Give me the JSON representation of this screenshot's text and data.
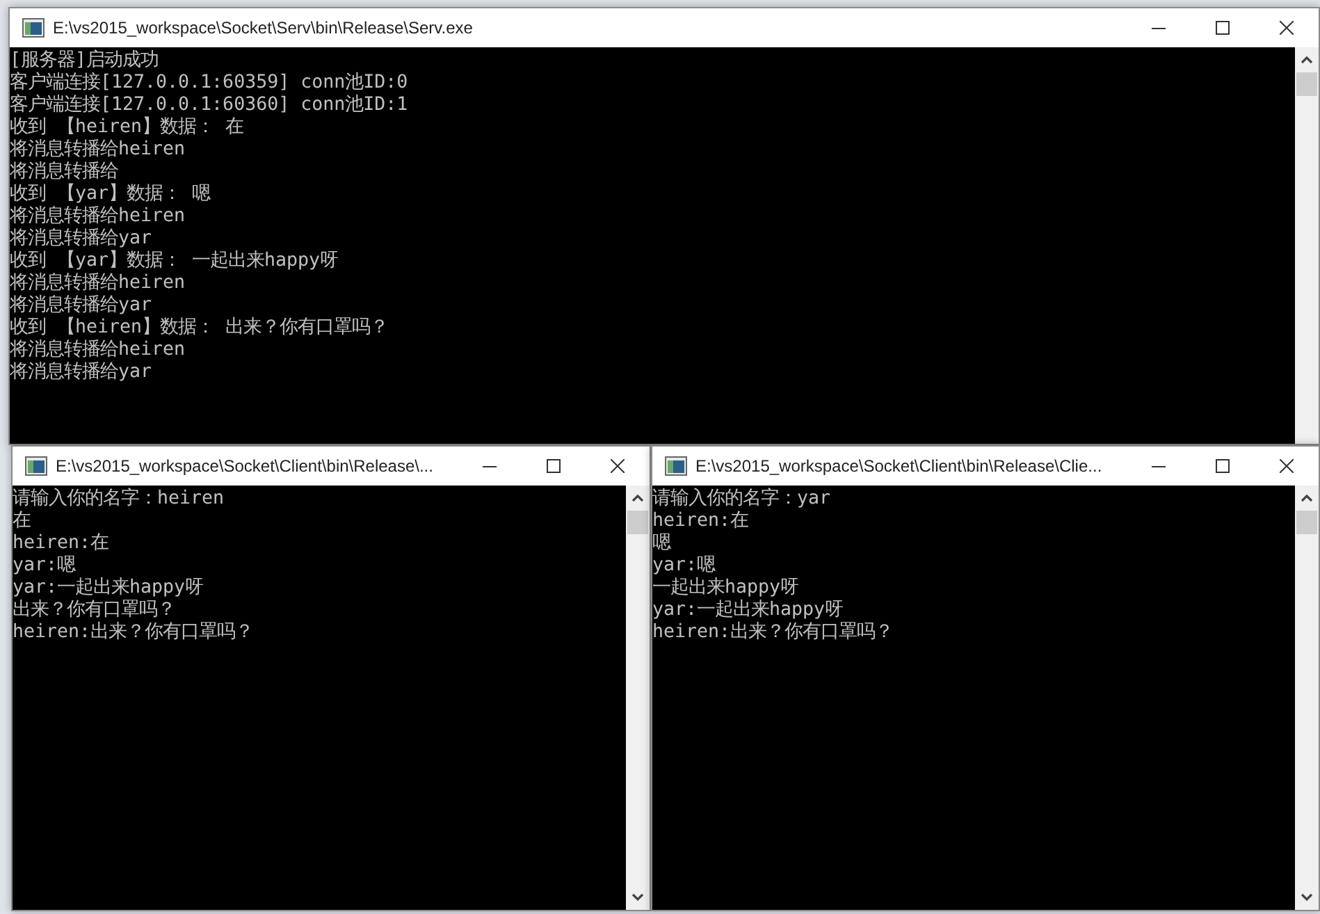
{
  "windows": [
    {
      "title": "E:\\vs2015_workspace\\Socket\\Serv\\bin\\Release\\Serv.exe",
      "lines": [
        "[服务器]启动成功",
        "客户端连接[127.0.0.1:60359] conn池ID:0",
        "客户端连接[127.0.0.1:60360] conn池ID:1",
        "收到 【heiren】数据： 在",
        "将消息转播给heiren",
        "将消息转播给",
        "收到 【yar】数据： 嗯",
        "将消息转播给heiren",
        "将消息转播给yar",
        "收到 【yar】数据： 一起出来happy呀",
        "将消息转播给heiren",
        "将消息转播给yar",
        "收到 【heiren】数据： 出来？你有口罩吗？",
        "将消息转播给heiren",
        "将消息转播给yar"
      ]
    },
    {
      "title": "E:\\vs2015_workspace\\Socket\\Client\\bin\\Release\\...",
      "lines": [
        "请输入你的名字：heiren",
        "在",
        "heiren:在",
        "yar:嗯",
        "yar:一起出来happy呀",
        "出来？你有口罩吗？",
        "heiren:出来？你有口罩吗？"
      ]
    },
    {
      "title": "E:\\vs2015_workspace\\Socket\\Client\\bin\\Release\\Clie...",
      "lines": [
        "请输入你的名字：yar",
        "heiren:在",
        "嗯",
        "yar:嗯",
        "一起出来happy呀",
        "yar:一起出来happy呀",
        "heiren:出来？你有口罩吗？"
      ]
    }
  ]
}
